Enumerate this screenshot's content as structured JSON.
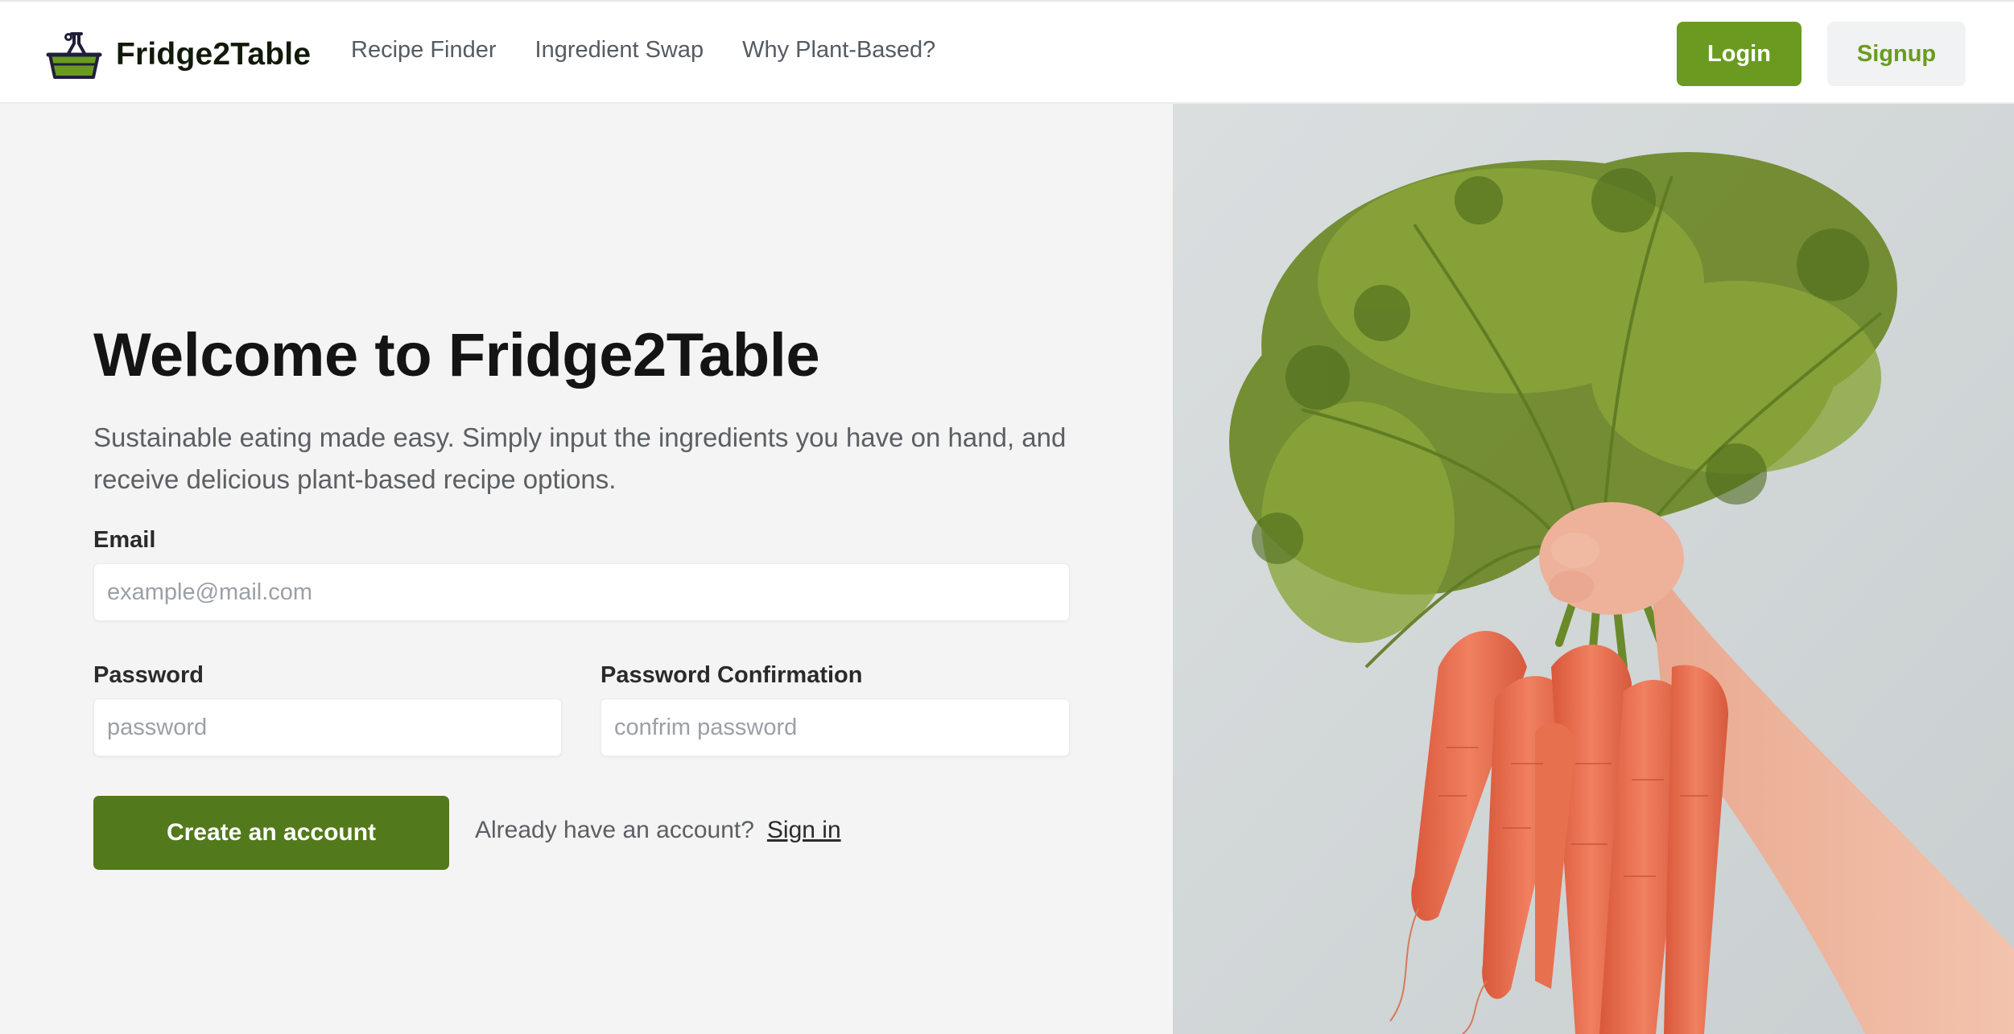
{
  "header": {
    "brand": "Fridge2Table",
    "nav": [
      "Recipe Finder",
      "Ingredient Swap",
      "Why Plant-Based?"
    ],
    "login_label": "Login",
    "signup_label": "Signup"
  },
  "hero": {
    "title": "Welcome to Fridge2Table",
    "subtitle": "Sustainable eating made easy. Simply input the ingredients you have on hand, and receive delicious plant-based recipe options."
  },
  "form": {
    "email_label": "Email",
    "email_placeholder": "example@mail.com",
    "password_label": "Password",
    "password_placeholder": "password",
    "confirm_label": "Password Confirmation",
    "confirm_placeholder": "confrim password",
    "submit_label": "Create an account",
    "signin_prompt": "Already have an account?",
    "signin_link": "Sign in"
  },
  "colors": {
    "brand_green": "#6a9b20",
    "button_green": "#52791b",
    "page_bg": "#f4f4f4"
  },
  "icons": {
    "logo": "basket-flask-icon"
  }
}
